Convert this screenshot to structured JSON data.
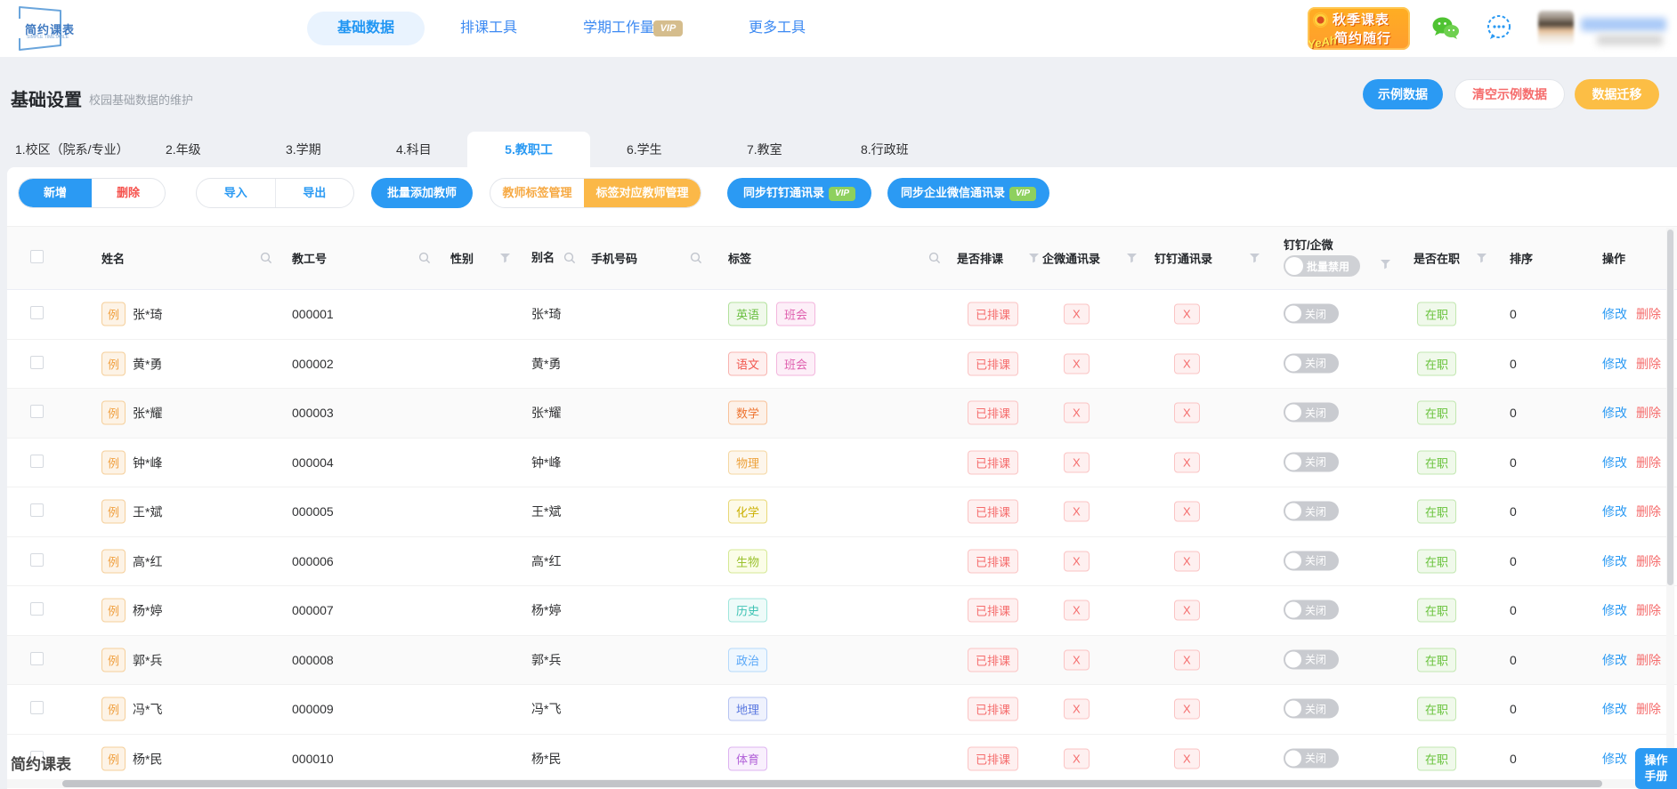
{
  "nav": {
    "logo_title": "简约课表",
    "logo_subtitle": "SIMPLE TIMETABLE",
    "items": [
      {
        "label": "基础数据"
      },
      {
        "label": "排课工具"
      },
      {
        "label": "学期工作量"
      },
      {
        "label": "更多工具"
      }
    ],
    "vip_label": "VIP",
    "promo_line1": "秋季课表",
    "promo_line2": "简约随行",
    "promo_yeah": "YeAh"
  },
  "page": {
    "title": "基础设置",
    "subtitle": "校园基础数据的维护",
    "btn_sample": "示例数据",
    "btn_clear_sample": "清空示例数据",
    "btn_migrate": "数据迁移"
  },
  "tabs": [
    {
      "label": "1.校区（院系/专业）"
    },
    {
      "label": "2.年级"
    },
    {
      "label": "3.学期"
    },
    {
      "label": "4.科目"
    },
    {
      "label": "5.教职工"
    },
    {
      "label": "6.学生"
    },
    {
      "label": "7.教室"
    },
    {
      "label": "8.行政班"
    }
  ],
  "toolbar": {
    "add": "新增",
    "delete": "删除",
    "import": "导入",
    "export": "导出",
    "batch_add": "批量添加教师",
    "tag_manage": "教师标签管理",
    "tag_teacher_manage": "标签对应教师管理",
    "sync_dingtalk": "同步钉钉通讯录",
    "sync_wecom": "同步企业微信通讯录",
    "vip_label": "VIP"
  },
  "table": {
    "col_name": "姓名",
    "col_empno": "教工号",
    "col_gender": "性别",
    "col_alias": "别名",
    "col_phone": "手机号码",
    "col_tags": "标签",
    "col_scheduled": "是否排课",
    "col_wecom": "企微通讯录",
    "col_dingtalk": "钉钉通讯录",
    "col_dd_qw": "钉钉/企微",
    "batch_disable": "批量禁用",
    "col_onjob": "是否在职",
    "col_sort": "排序",
    "col_ops": "操作",
    "sample_badge": "例",
    "scheduled_value": "已排课",
    "x_value": "X",
    "toggle_value": "关闭",
    "onjob_value": "在职",
    "op_modify": "修改",
    "op_delete": "删除",
    "rows": [
      {
        "name": "张*琦",
        "empno": "000001",
        "alias": "张*琦",
        "sort": "0",
        "row_cls": "trow",
        "tags": [
          {
            "label": "英语",
            "cls": "tag auto-hide t-green"
          },
          {
            "label": "班会",
            "cls": "tag auto-hide t-pink"
          }
        ]
      },
      {
        "name": "黄*勇",
        "empno": "000002",
        "alias": "黄*勇",
        "sort": "0",
        "row_cls": "trow",
        "tags": [
          {
            "label": "语文",
            "cls": "tag auto-hide t-red"
          },
          {
            "label": "班会",
            "cls": "tag auto-hide t-pink"
          }
        ]
      },
      {
        "name": "张*耀",
        "empno": "000003",
        "alias": "张*耀",
        "sort": "0",
        "row_cls": "trow striped",
        "tags": [
          {
            "label": "数学",
            "cls": "tag auto-hide t-orange"
          }
        ]
      },
      {
        "name": "钟*峰",
        "empno": "000004",
        "alias": "钟*峰",
        "sort": "0",
        "row_cls": "trow",
        "tags": [
          {
            "label": "物理",
            "cls": "tag auto-hide t-amber"
          }
        ]
      },
      {
        "name": "王*斌",
        "empno": "000005",
        "alias": "王*斌",
        "sort": "0",
        "row_cls": "trow",
        "tags": [
          {
            "label": "化学",
            "cls": "tag auto-hide t-yellow"
          }
        ]
      },
      {
        "name": "高*红",
        "empno": "000006",
        "alias": "高*红",
        "sort": "0",
        "row_cls": "trow",
        "tags": [
          {
            "label": "生物",
            "cls": "tag auto-hide t-lime"
          }
        ]
      },
      {
        "name": "杨*婷",
        "empno": "000007",
        "alias": "杨*婷",
        "sort": "0",
        "row_cls": "trow",
        "tags": [
          {
            "label": "历史",
            "cls": "tag auto-hide t-teal"
          }
        ]
      },
      {
        "name": "郭*兵",
        "empno": "000008",
        "alias": "郭*兵",
        "sort": "0",
        "row_cls": "trow striped",
        "tags": [
          {
            "label": "政治",
            "cls": "tag auto-hide t-lblue"
          }
        ]
      },
      {
        "name": "冯*飞",
        "empno": "000009",
        "alias": "冯*飞",
        "sort": "0",
        "row_cls": "trow",
        "tags": [
          {
            "label": "地理",
            "cls": "tag auto-hide t-blue"
          }
        ]
      },
      {
        "name": "杨*民",
        "empno": "000010",
        "alias": "杨*民",
        "sort": "0",
        "row_cls": "trow",
        "tags": [
          {
            "label": "体育",
            "cls": "tag auto-hide t-purple"
          }
        ]
      }
    ]
  },
  "misc": {
    "watermark": "简约课表",
    "manual_line1": "操作",
    "manual_line2": "手册"
  },
  "icons": {
    "search": "magnifier",
    "filter": "funnel",
    "wechat": "wechat-bubbles",
    "feedback": "chat-bubble-dots",
    "sun": "sun-burst"
  },
  "colors": {
    "primary_blue": "#2b9af3",
    "nav_pill_bg": "#e9f3fe",
    "orange_button": "#fcbe45",
    "toolbar_orange": "#fbb848",
    "danger_red": "#f56c6c",
    "success_green": "#67c23a",
    "vip_tan": "#d5bd8d",
    "vip_green": "#8ed05e",
    "promo_orange": "#ffa426",
    "page_bg": "#eef0f4"
  }
}
